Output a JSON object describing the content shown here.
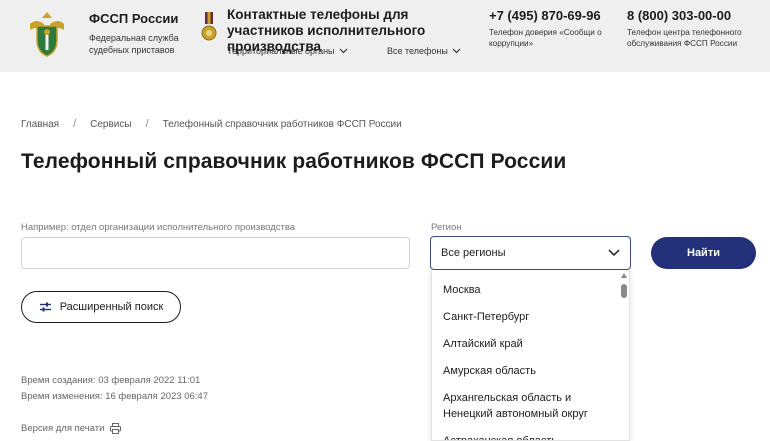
{
  "header": {
    "brand_title": "ФССП России",
    "brand_subtitle": "Федеральная служба судебных приставов",
    "contacts_title": "Контактные телефоны для участников исполнительного производства",
    "link_territorial": "Территориальные органы",
    "link_all_phones": "Все телефоны",
    "trust_phone": "+7 (495) 870-69-96",
    "trust_phone_note": "Телефон доверия «Сообщи о коррупции»",
    "center_phone": "8 (800) 303-00-00",
    "center_phone_note": "Телефон центра телефонного обслуживания ФССП России"
  },
  "breadcrumb": {
    "items": [
      "Главная",
      "Сервисы",
      "Телефонный справочник работников ФССП России"
    ],
    "separator": "/"
  },
  "page_title": "Телефонный справочник работников ФССП России",
  "search": {
    "label": "Например: отдел организации исполнительного производства",
    "value": "",
    "region_label": "Регион",
    "region_value": "Все регионы",
    "find_label": "Найти"
  },
  "dropdown": {
    "options": [
      "Москва",
      "Санкт-Петербург",
      "Алтайский край",
      "Амурская область",
      "Архангельская область и Ненецкий автономный округ",
      "Астраханская область"
    ]
  },
  "advanced_search_label": "Расширенный поиск",
  "meta": {
    "created": "Время создания: 03 февраля 2022 11:01",
    "modified": "Время изменения: 16 февраля 2023 06:47"
  },
  "print_label": "Версия для печати",
  "colors": {
    "header_bg": "#efefef",
    "accent": "#23307a",
    "select_border": "#3b4a8f"
  }
}
